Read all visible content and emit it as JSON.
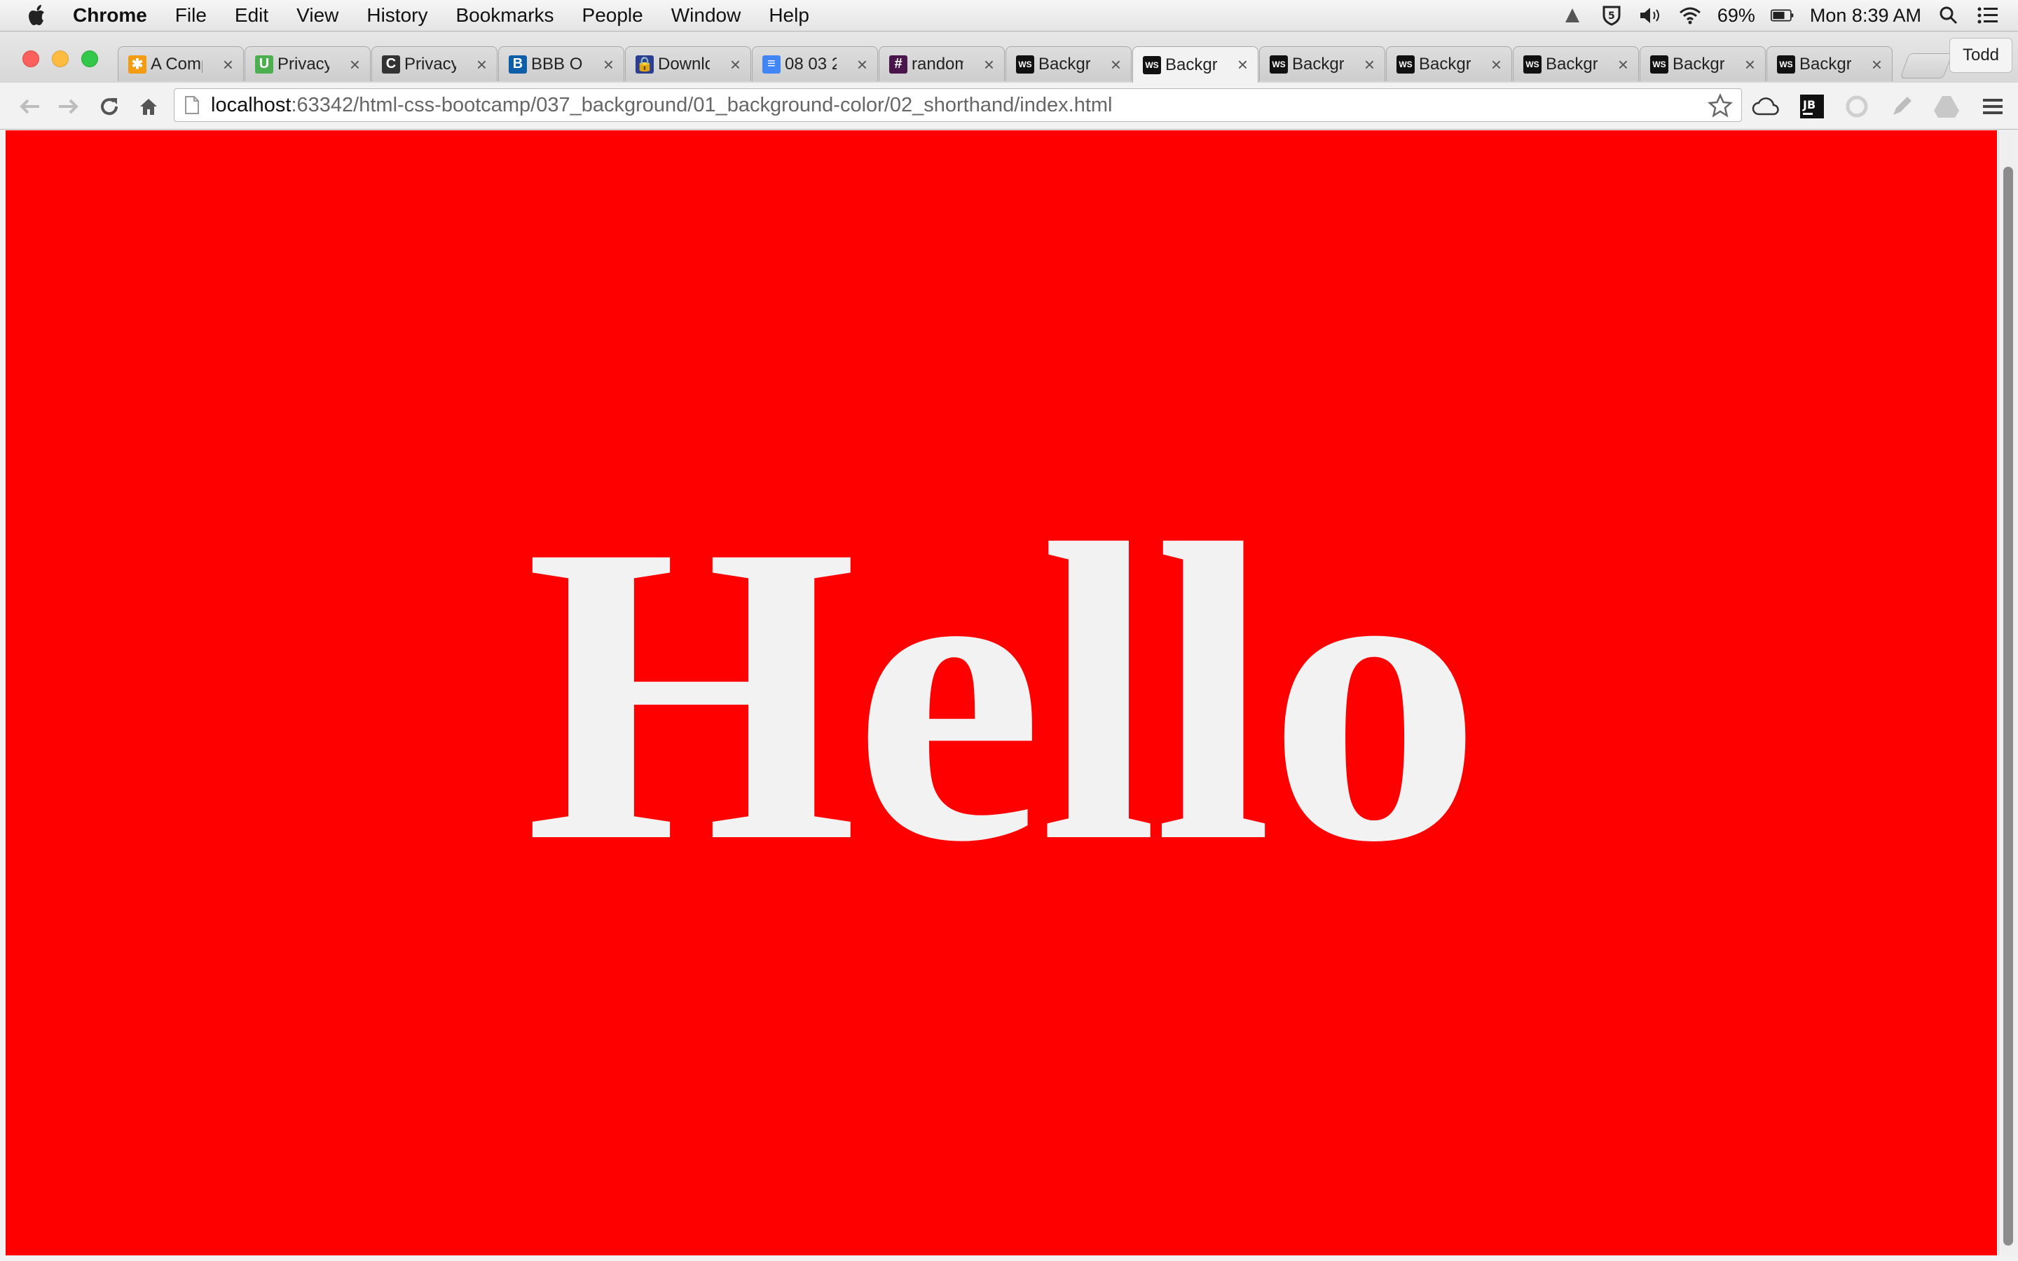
{
  "menubar": {
    "app": "Chrome",
    "items": [
      "File",
      "Edit",
      "View",
      "History",
      "Bookmarks",
      "People",
      "Window",
      "Help"
    ],
    "battery": "69%",
    "clock": "Mon 8:39 AM"
  },
  "tabs": [
    {
      "title": "A Comp",
      "icon": "asterisk-favicon",
      "color": "#f39c12"
    },
    {
      "title": "Privacy",
      "icon": "u-favicon",
      "color": "#4caf50"
    },
    {
      "title": "Privacy",
      "icon": "c-favicon",
      "color": "#333333"
    },
    {
      "title": "BBB Ol",
      "icon": "bbb-favicon",
      "color": "#0d5ea8"
    },
    {
      "title": "Downlo",
      "icon": "lock-favicon",
      "color": "#2c3e91"
    },
    {
      "title": "08 03 2",
      "icon": "docs-favicon",
      "color": "#4285f4"
    },
    {
      "title": "random",
      "icon": "slack-favicon",
      "color": "#4a154b"
    },
    {
      "title": "Backgr",
      "icon": "ws-favicon",
      "color": "#111111"
    },
    {
      "title": "Backgr",
      "icon": "ws-favicon",
      "color": "#111111",
      "active": true
    },
    {
      "title": "Backgr",
      "icon": "ws-favicon",
      "color": "#111111"
    },
    {
      "title": "Backgr",
      "icon": "ws-favicon",
      "color": "#111111"
    },
    {
      "title": "Backgr",
      "icon": "ws-favicon",
      "color": "#111111"
    },
    {
      "title": "Backgr",
      "icon": "ws-favicon",
      "color": "#111111"
    },
    {
      "title": "Backgr",
      "icon": "ws-favicon",
      "color": "#111111"
    }
  ],
  "profile": "Todd",
  "address": {
    "host": "localhost",
    "path": ":63342/html-css-bootcamp/037_background/01_background-color/02_shorthand/index.html"
  },
  "page": {
    "heading": "Hello",
    "background": "#ff0000",
    "text_color": "#f2f2f2"
  }
}
